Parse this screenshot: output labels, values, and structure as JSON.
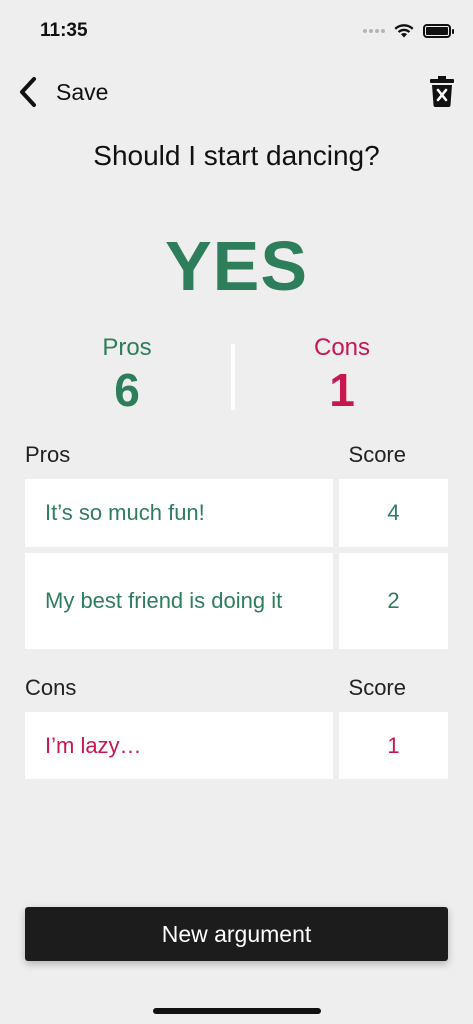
{
  "status_bar": {
    "time": "11:35",
    "icons": [
      "cellular-icon",
      "wifi-icon",
      "battery-icon"
    ]
  },
  "nav": {
    "back_label": "Save",
    "back_icon": "chevron-left-icon",
    "trash_icon": "trash-icon"
  },
  "question": "Should I start dancing?",
  "verdict": {
    "text": "YES"
  },
  "totals": {
    "pros_label": "Pros",
    "pros_value": "6",
    "cons_label": "Cons",
    "cons_value": "1"
  },
  "pros_section": {
    "header": "Pros",
    "score_header": "Score",
    "items": [
      {
        "text": "It’s so much fun!",
        "score": "4"
      },
      {
        "text": "My best friend is doing it",
        "score": "2"
      }
    ]
  },
  "cons_section": {
    "header": "Cons",
    "score_header": "Score",
    "items": [
      {
        "text": "I’m lazy…",
        "score": "1"
      }
    ]
  },
  "new_argument_label": "New argument",
  "colors": {
    "pro": "#2e7d5b",
    "con": "#c8174f",
    "background": "#eeeeee",
    "button": "#1c1c1c"
  }
}
